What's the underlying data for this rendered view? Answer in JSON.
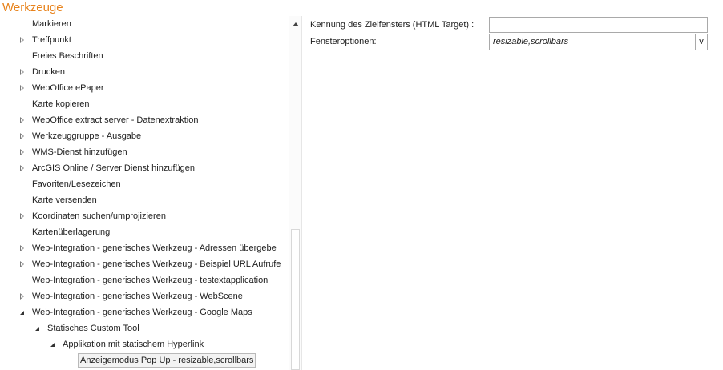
{
  "panel": {
    "title": "Werkzeuge"
  },
  "tree": [
    {
      "label": "Markieren",
      "level": 0,
      "expander": "none"
    },
    {
      "label": "Treffpunkt",
      "level": 0,
      "expander": "collapsed"
    },
    {
      "label": "Freies Beschriften",
      "level": 0,
      "expander": "none"
    },
    {
      "label": "Drucken",
      "level": 0,
      "expander": "collapsed"
    },
    {
      "label": "WebOffice ePaper",
      "level": 0,
      "expander": "collapsed"
    },
    {
      "label": "Karte kopieren",
      "level": 0,
      "expander": "none"
    },
    {
      "label": "WebOffice extract server - Datenextraktion",
      "level": 0,
      "expander": "collapsed"
    },
    {
      "label": "Werkzeuggruppe - Ausgabe",
      "level": 0,
      "expander": "collapsed"
    },
    {
      "label": "WMS-Dienst hinzufügen",
      "level": 0,
      "expander": "collapsed"
    },
    {
      "label": "ArcGIS Online / Server Dienst hinzufügen",
      "level": 0,
      "expander": "collapsed"
    },
    {
      "label": "Favoriten/Lesezeichen",
      "level": 0,
      "expander": "none"
    },
    {
      "label": "Karte versenden",
      "level": 0,
      "expander": "none"
    },
    {
      "label": "Koordinaten suchen/umprojizieren",
      "level": 0,
      "expander": "collapsed"
    },
    {
      "label": "Kartenüberlagerung",
      "level": 0,
      "expander": "none"
    },
    {
      "label": "Web-Integration - generisches Werkzeug - Adressen übergebe",
      "level": 0,
      "expander": "collapsed"
    },
    {
      "label": "Web-Integration - generisches Werkzeug - Beispiel URL Aufrufe",
      "level": 0,
      "expander": "collapsed"
    },
    {
      "label": "Web-Integration - generisches Werkzeug - testextapplication",
      "level": 0,
      "expander": "none"
    },
    {
      "label": "Web-Integration - generisches Werkzeug - WebScene",
      "level": 0,
      "expander": "collapsed"
    },
    {
      "label": "Web-Integration - generisches Werkzeug - Google Maps",
      "level": 0,
      "expander": "expanded"
    },
    {
      "label": "Statisches Custom Tool",
      "level": 1,
      "expander": "expanded"
    },
    {
      "label": "Applikation mit statischem Hyperlink",
      "level": 2,
      "expander": "expanded"
    },
    {
      "label": "Anzeigemodus Pop Up - resizable,scrollbars",
      "level": 3,
      "expander": "none",
      "selected": true
    }
  ],
  "properties": {
    "target_label": "Kennung des Zielfensters (HTML Target) :",
    "target_value": "",
    "options_label": "Fensteroptionen:",
    "options_value": "resizable,scrollbars",
    "options_button": "v"
  },
  "icons": {
    "collapsed": "triangle-right-outline-icon",
    "expanded": "triangle-down-filled-icon",
    "scroll_up": "scroll-up-arrow-icon"
  },
  "colors": {
    "title": "#e8831c",
    "text": "#1e1e1e",
    "border": "#a9a9a9"
  }
}
